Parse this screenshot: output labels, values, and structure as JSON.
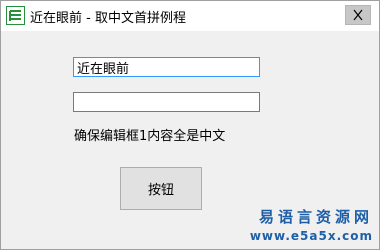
{
  "window": {
    "title": "近在眼前 - 取中文首拼例程",
    "icon": "green-app-icon",
    "close_icon": "close-icon"
  },
  "form": {
    "input1_value": "近在眼前",
    "input2_value": "",
    "hint_label": "确保编辑框1内容全是中文",
    "button_label": "按钮"
  },
  "watermark": {
    "title": "易语言资源网",
    "url": "www.e5a5x.com"
  },
  "colors": {
    "focus_border": "#3399ff",
    "watermark": "#1e5fa8"
  }
}
